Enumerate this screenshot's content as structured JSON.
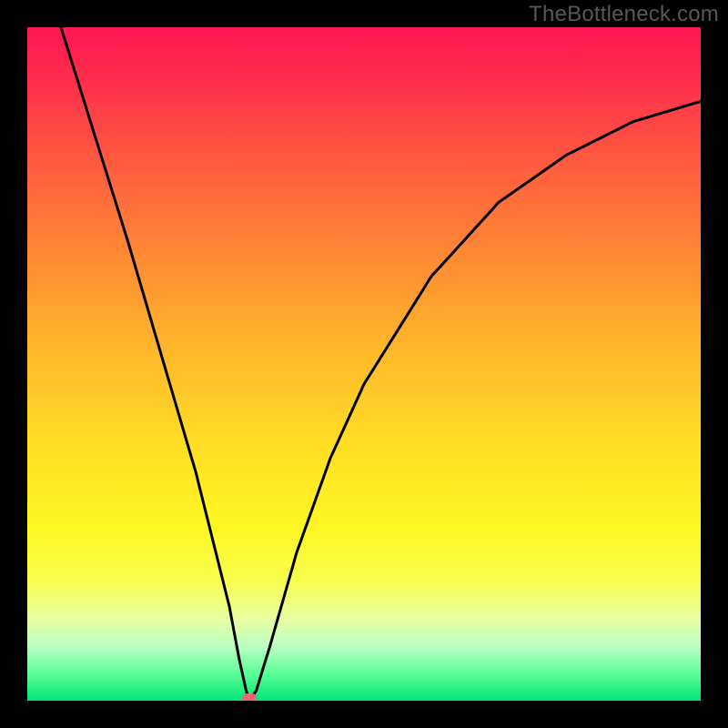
{
  "watermark": "TheBottleneck.com",
  "chart_data": {
    "type": "line",
    "title": "",
    "xlabel": "",
    "ylabel": "",
    "xlim": [
      0,
      100
    ],
    "ylim": [
      0,
      100
    ],
    "grid": false,
    "legend": false,
    "background": "rainbow-gradient (red top → green bottom)",
    "marker": {
      "x": 33,
      "y": 0,
      "color": "#e46a6d"
    },
    "series": [
      {
        "name": "curve",
        "color": "#000000",
        "x": [
          5,
          10,
          15,
          20,
          25,
          28,
          30,
          31.5,
          32.5,
          33,
          34,
          36,
          40,
          45,
          50,
          60,
          70,
          80,
          90,
          100
        ],
        "y": [
          100,
          84,
          68,
          51,
          34,
          22,
          14,
          6,
          1.5,
          0,
          1.5,
          8,
          22,
          36,
          47,
          63,
          74,
          81,
          86,
          89
        ]
      }
    ],
    "notes": "V-shaped curve with minimum at x≈33, y=0. Left branch near-linear, right branch concave approaching y≈90."
  },
  "colors": {
    "frame": "#000000",
    "watermark": "#575757",
    "curve": "#000000",
    "marker": "#e46a6d"
  }
}
